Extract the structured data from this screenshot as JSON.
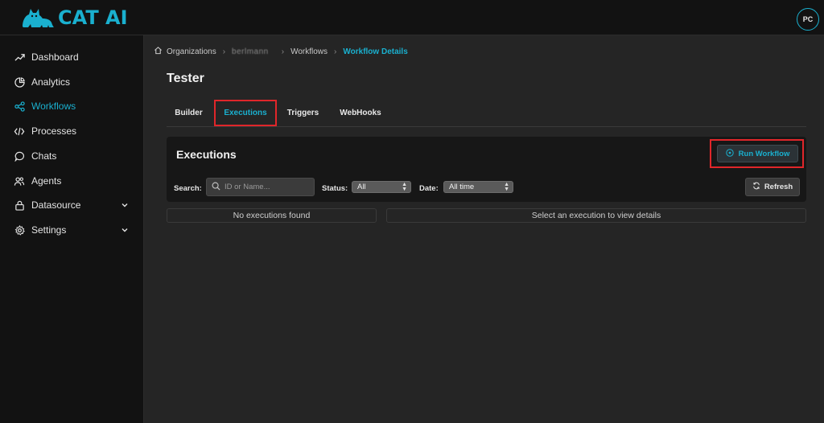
{
  "app": {
    "brand": "CAT AI",
    "avatar_initials": "PC",
    "accent_color": "#1ab0cf",
    "highlight_color": "#e0262a"
  },
  "sidebar": {
    "items": [
      {
        "label": "Dashboard",
        "icon": "trending-up-icon",
        "active": false
      },
      {
        "label": "Analytics",
        "icon": "pie-chart-icon",
        "active": false
      },
      {
        "label": "Workflows",
        "icon": "share-nodes-icon",
        "active": true
      },
      {
        "label": "Processes",
        "icon": "code-icon",
        "active": false
      },
      {
        "label": "Chats",
        "icon": "chat-bubble-icon",
        "active": false
      },
      {
        "label": "Agents",
        "icon": "users-icon",
        "active": false
      },
      {
        "label": "Datasource",
        "icon": "database-lock-icon",
        "active": false,
        "expandable": true
      },
      {
        "label": "Settings",
        "icon": "gear-icon",
        "active": false,
        "expandable": true
      }
    ]
  },
  "breadcrumb": {
    "organizations": "Organizations",
    "org_name": "berlmann",
    "workflows": "Workflows",
    "current": "Workflow Details"
  },
  "page": {
    "title": "Tester"
  },
  "tabs": [
    {
      "label": "Builder",
      "active": false
    },
    {
      "label": "Executions",
      "active": true
    },
    {
      "label": "Triggers",
      "active": false
    },
    {
      "label": "WebHooks",
      "active": false
    }
  ],
  "executions": {
    "title": "Executions",
    "run_button": "Run Workflow",
    "search_label": "Search:",
    "search_placeholder": "ID or Name...",
    "status_label": "Status:",
    "status_value": "All",
    "date_label": "Date:",
    "date_value": "All time",
    "refresh_button": "Refresh",
    "empty_list": "No executions found",
    "empty_details": "Select an execution to view details"
  }
}
